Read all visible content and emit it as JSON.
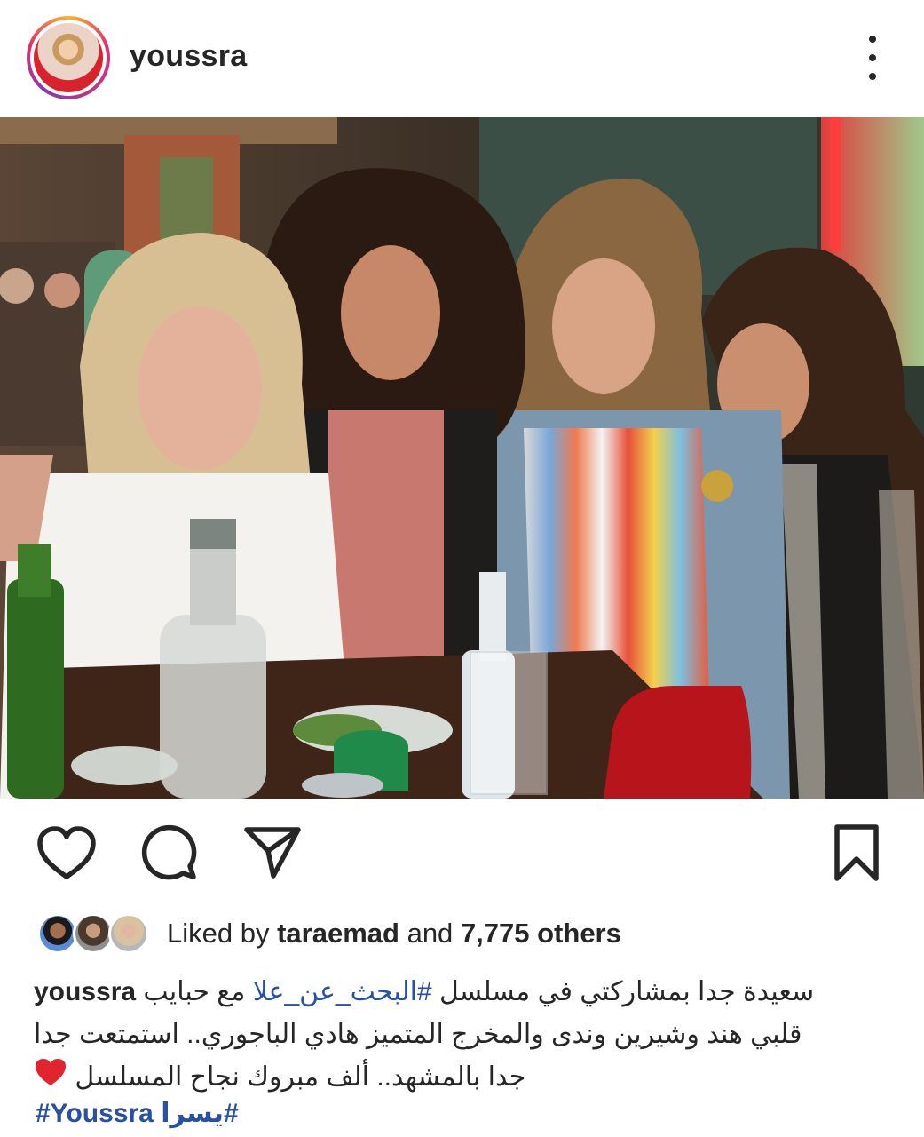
{
  "post": {
    "username": "youssra"
  },
  "header": {
    "more_icon": "more-vertical-icon"
  },
  "actions": {
    "icons": [
      "heart-icon",
      "comment-icon",
      "share-icon",
      "bookmark-icon"
    ]
  },
  "likes": {
    "prefix": "Liked by",
    "user": "taraemad",
    "connector": "and",
    "others": "7,775 others"
  },
  "caption": {
    "username": "youssra",
    "line1_text_before": "سعيدة جدا بمشاركتي في مسلسل",
    "line1_tag": "#البحث_عن_علا",
    "line1_text_after": "مع حبايب",
    "line2": "قلبي هند وشيرين وندى والمخرج المتميز هادي الباجوري.. استمتعت جدا",
    "line3": "جدا بالمشهد.. ألف مبروك نجاح المسلسل",
    "emoji": "red-heart-emoji",
    "hashtag_1": "#Youssra",
    "hashtag_2": "#يسرا"
  },
  "colors": {
    "text": "#262626",
    "link": "#2750a7",
    "heart": "#e0252e"
  }
}
